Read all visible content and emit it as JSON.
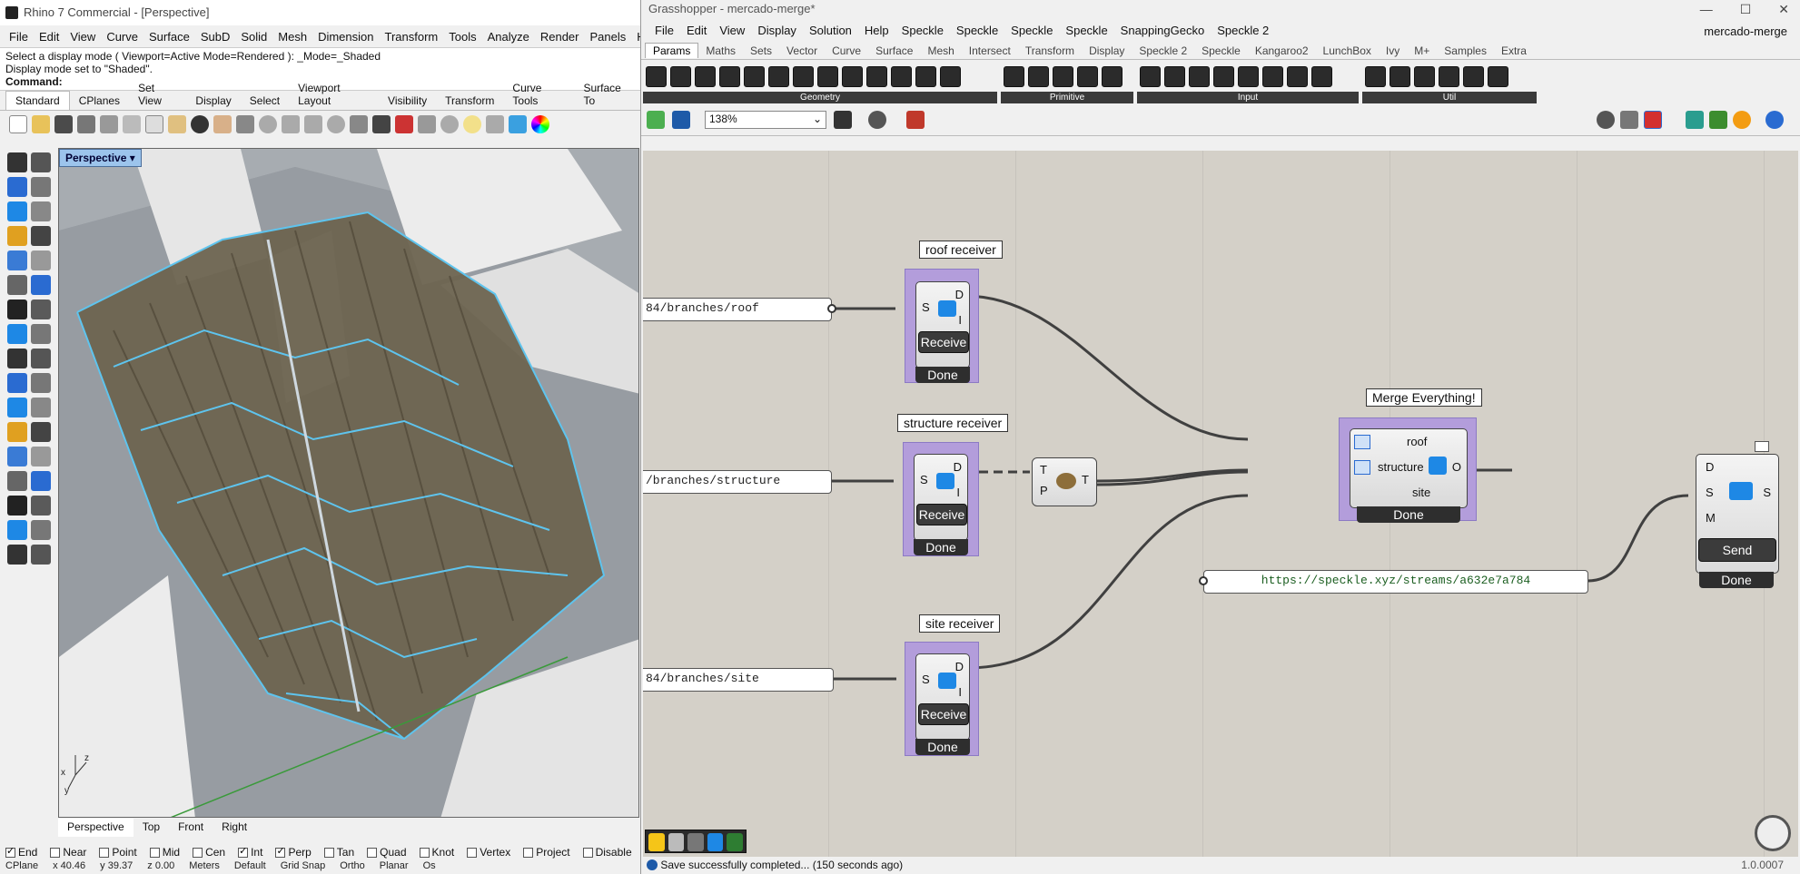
{
  "rhino": {
    "title": "Rhino 7 Commercial - [Perspective]",
    "menu": [
      "File",
      "Edit",
      "View",
      "Curve",
      "Surface",
      "SubD",
      "Solid",
      "Mesh",
      "Dimension",
      "Transform",
      "Tools",
      "Analyze",
      "Render",
      "Panels",
      "Help"
    ],
    "command_history": [
      "Select a display mode ( Viewport=Active  Mode=Rendered ): _Mode=_Shaded",
      "Display mode set to \"Shaded\"."
    ],
    "command_prompt": "Command:",
    "toolbar_tabs": [
      "Standard",
      "CPlanes",
      "Set View",
      "Display",
      "Select",
      "Viewport Layout",
      "Visibility",
      "Transform",
      "Curve Tools",
      "Surface To"
    ],
    "viewport_title": "Perspective",
    "viewport_tabs": [
      "Perspective",
      "Top",
      "Front",
      "Right"
    ],
    "osnaps": [
      {
        "label": "End",
        "checked": true
      },
      {
        "label": "Near",
        "checked": false
      },
      {
        "label": "Point",
        "checked": false
      },
      {
        "label": "Mid",
        "checked": false
      },
      {
        "label": "Cen",
        "checked": false
      },
      {
        "label": "Int",
        "checked": true
      },
      {
        "label": "Perp",
        "checked": true
      },
      {
        "label": "Tan",
        "checked": false
      },
      {
        "label": "Quad",
        "checked": false
      },
      {
        "label": "Knot",
        "checked": false
      },
      {
        "label": "Vertex",
        "checked": false
      },
      {
        "label": "Project",
        "checked": false
      },
      {
        "label": "Disable",
        "checked": false
      }
    ],
    "status": [
      "CPlane",
      "x 40.46",
      "y 39.37",
      "z 0.00",
      "Meters",
      "Default",
      "Grid Snap",
      "Ortho",
      "Planar",
      "Os"
    ]
  },
  "gh": {
    "title": "Grasshopper - mercado-merge*",
    "document_name": "mercado-merge",
    "menu": [
      "File",
      "Edit",
      "View",
      "Display",
      "Solution",
      "Help",
      "Speckle",
      "Speckle",
      "Speckle",
      "Speckle",
      "SnappingGecko",
      "Speckle 2"
    ],
    "tabs": [
      "Params",
      "Maths",
      "Sets",
      "Vector",
      "Curve",
      "Surface",
      "Mesh",
      "Intersect",
      "Transform",
      "Display",
      "Speckle 2",
      "Speckle",
      "Kangaroo2",
      "LunchBox",
      "Ivy",
      "M+",
      "Samples",
      "Extra"
    ],
    "ribbon_groups": [
      "Geometry",
      "Primitive",
      "Input",
      "Util"
    ],
    "zoom": "138%",
    "receivers": [
      {
        "bubble": "roof receiver",
        "panel": "84/branches/roof",
        "button": "Receive",
        "done": "Done"
      },
      {
        "bubble": "structure receiver",
        "panel": "/branches/structure",
        "button": "Receive",
        "done": "Done"
      },
      {
        "bubble": "site receiver",
        "panel": "84/branches/site",
        "button": "Receive",
        "done": "Done"
      }
    ],
    "receiver_ports": {
      "in": "S",
      "out1": "D",
      "out2": "I"
    },
    "tree_ports": {
      "in1": "T",
      "in2": "P",
      "out": "T"
    },
    "merge": {
      "bubble": "Merge Everything!",
      "inputs": [
        "roof",
        "structure",
        "site"
      ],
      "output": "O",
      "done": "Done"
    },
    "sender": {
      "inputs": [
        "D",
        "S",
        "M"
      ],
      "output": "S",
      "button": "Send",
      "done": "Done"
    },
    "stream_url": "https://speckle.xyz/streams/a632e7a784",
    "status_message": "Save successfully completed... (150 seconds ago)",
    "version": "1.0.0007"
  }
}
